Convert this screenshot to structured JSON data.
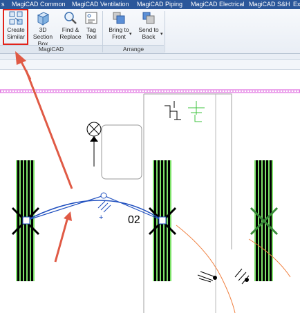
{
  "ribbon_tabs": [
    {
      "label": "s"
    },
    {
      "label": "MagiCAD Common"
    },
    {
      "label": "MagiCAD Ventilation"
    },
    {
      "label": "MagiCAD Piping"
    },
    {
      "label": "MagiCAD Electrical"
    },
    {
      "label": "MagiCAD S&H"
    },
    {
      "label": "Ex"
    }
  ],
  "magicad_panel": {
    "label": "MagiCAD",
    "tools": [
      {
        "line1": "Create",
        "line2": "Similar",
        "icon": "create-similar-icon"
      },
      {
        "line1": "3D",
        "line2": "Section Box",
        "icon": "section-box-icon"
      },
      {
        "line1": "Find &",
        "line2": "Replace",
        "icon": "find-replace-icon"
      },
      {
        "line1": "Tag",
        "line2": "Tool",
        "icon": "tag-tool-icon"
      }
    ]
  },
  "arrange_panel": {
    "label": "Arrange",
    "tools": [
      {
        "line1": "Bring to",
        "line2": "Front",
        "icon": "bring-to-front-icon"
      },
      {
        "line1": "Send to",
        "line2": "Back",
        "icon": "send-to-back-icon"
      }
    ]
  },
  "drawing": {
    "dimension_text": "02"
  },
  "colors": {
    "ribbon_tab_bg": "#2b579a",
    "highlight_red": "#e2231a",
    "arrow_red": "#e05a45",
    "light_green": "#7ee26a",
    "pipe_blue": "#1f4fbf",
    "duct_orange": "#f08040",
    "magenta_wall": "#d94fd9"
  }
}
